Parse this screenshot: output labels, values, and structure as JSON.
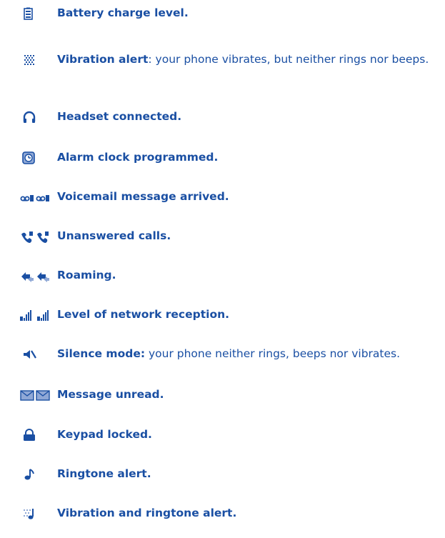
{
  "colors": {
    "text": "#1a4fa3",
    "icon": "#1a4fa3",
    "icon_light": "#8fa8d6"
  },
  "items": [
    {
      "icon": "battery-icon",
      "term": "Battery charge level.",
      "desc": ""
    },
    {
      "icon": "vibration-icon",
      "term": "Vibration alert",
      "desc": ": your phone vibrates, but neither rings nor beeps."
    },
    {
      "icon": "headset-icon",
      "term": "Headset connected.",
      "desc": ""
    },
    {
      "icon": "alarm-clock-icon",
      "term": "Alarm clock programmed.",
      "desc": ""
    },
    {
      "icon": "voicemail-icon",
      "term": "Voicemail message arrived.",
      "desc": ""
    },
    {
      "icon": "missed-call-icon",
      "term": "Unanswered calls.",
      "desc": ""
    },
    {
      "icon": "roaming-icon",
      "term": "Roaming.",
      "desc": ""
    },
    {
      "icon": "signal-strength-icon",
      "term": "Level of network reception.",
      "desc": ""
    },
    {
      "icon": "silence-icon",
      "term": "Silence mode:",
      "desc": " your phone neither rings, beeps nor vibrates."
    },
    {
      "icon": "unread-message-icon",
      "term": "Message unread.",
      "desc": ""
    },
    {
      "icon": "keypad-lock-icon",
      "term": "Keypad locked.",
      "desc": ""
    },
    {
      "icon": "ringtone-icon",
      "term": "Ringtone alert.",
      "desc": ""
    },
    {
      "icon": "vibration-ringtone-icon",
      "term": "Vibration and ringtone alert.",
      "desc": ""
    }
  ]
}
